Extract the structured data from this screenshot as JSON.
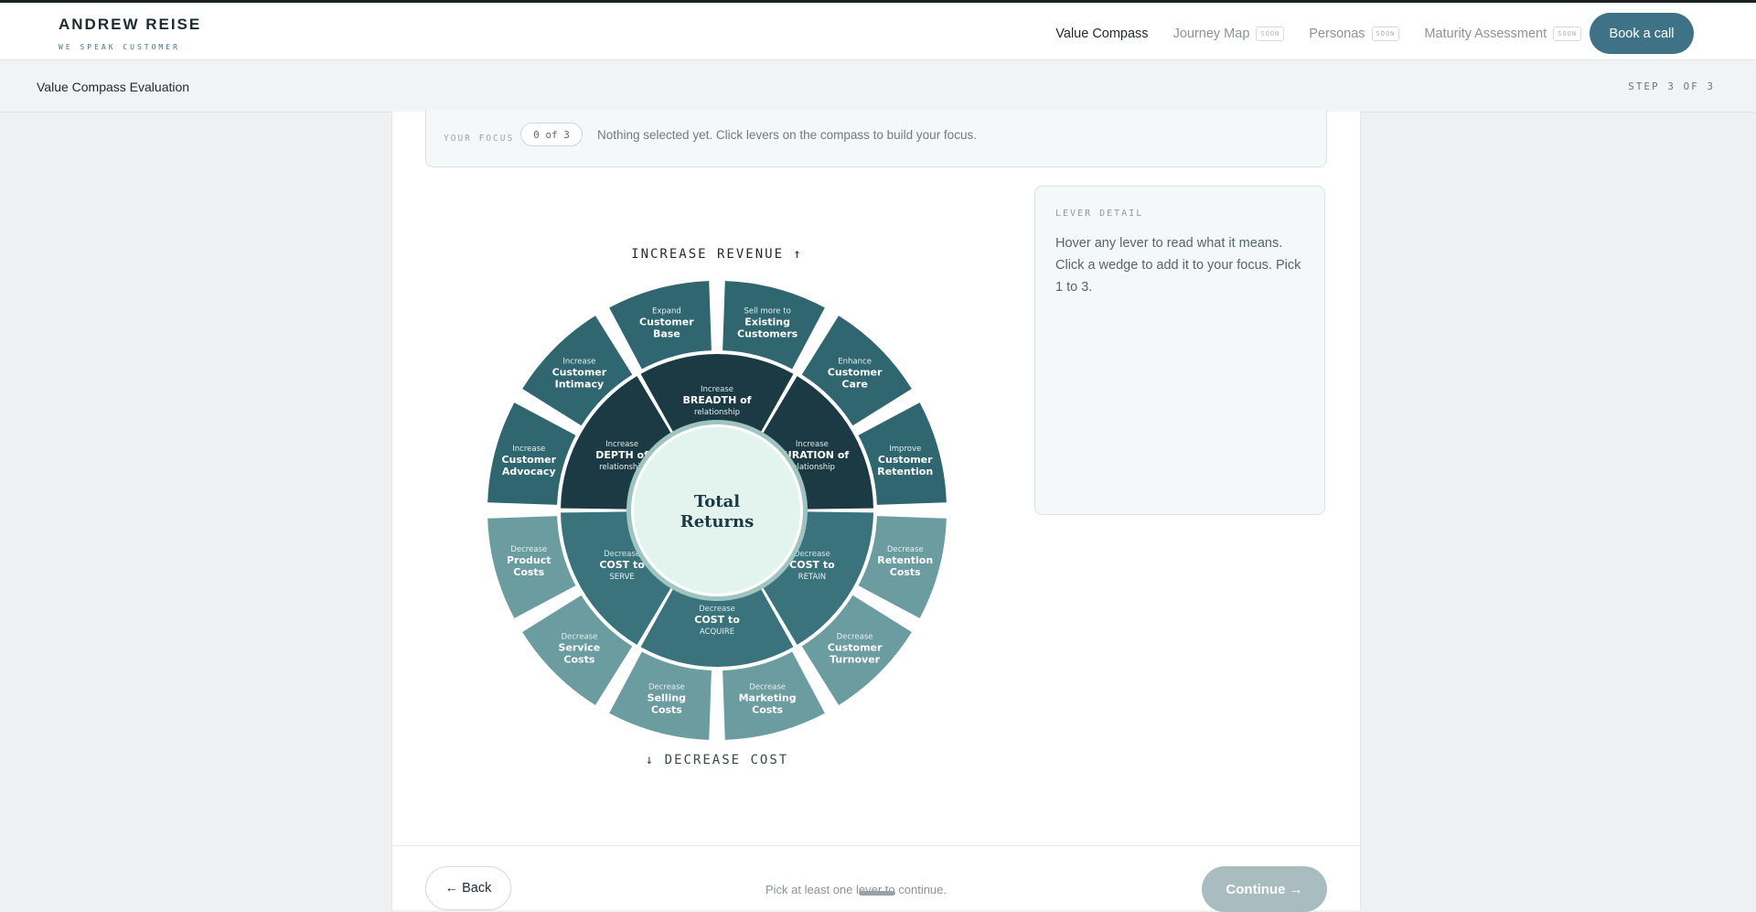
{
  "brand": {
    "name": "ANDREW REISE",
    "tagline": "WE SPEAK CUSTOMER"
  },
  "nav": {
    "items": [
      {
        "label": "Value Compass",
        "badge": ""
      },
      {
        "label": "Journey Map",
        "badge": "SOON"
      },
      {
        "label": "Personas",
        "badge": "SOON"
      },
      {
        "label": "Maturity Assessment",
        "badge": "SOON"
      }
    ],
    "cta": "Book a call"
  },
  "step": {
    "title": "Value Compass Evaluation",
    "counter": "STEP 3 OF 3"
  },
  "focus": {
    "label": "YOUR FOCUS",
    "count": "0 of 3",
    "hint": "Nothing selected yet. Click levers on the compass to build your focus."
  },
  "compass": {
    "top_label": "INCREASE REVENUE ↑",
    "bottom_label": "↓ DECREASE COST",
    "center": [
      "Total",
      "Returns"
    ],
    "outer": [
      {
        "pre": "Expand",
        "l1": "Customer",
        "l2": "Base"
      },
      {
        "pre": "Sell more to",
        "l1": "Existing",
        "l2": "Customers"
      },
      {
        "pre": "Enhance",
        "l1": "Customer",
        "l2": "Care"
      },
      {
        "pre": "Improve",
        "l1": "Customer",
        "l2": "Retention"
      },
      {
        "pre": "Decrease",
        "l1": "Retention",
        "l2": "Costs"
      },
      {
        "pre": "Decrease",
        "l1": "Customer",
        "l2": "Turnover"
      },
      {
        "pre": "Decrease",
        "l1": "Marketing",
        "l2": "Costs"
      },
      {
        "pre": "Decrease",
        "l1": "Selling",
        "l2": "Costs"
      },
      {
        "pre": "Decrease",
        "l1": "Service",
        "l2": "Costs"
      },
      {
        "pre": "Decrease",
        "l1": "Product",
        "l2": "Costs"
      },
      {
        "pre": "Increase",
        "l1": "Customer",
        "l2": "Advocacy"
      },
      {
        "pre": "Increase",
        "l1": "Customer",
        "l2": "Intimacy"
      }
    ],
    "inner": [
      {
        "pre": "Increase",
        "main": "BREADTH of",
        "sub": "relationship"
      },
      {
        "pre": "Increase",
        "main": "DURATION of",
        "sub": "relationship"
      },
      {
        "pre": "Decrease",
        "main": "COST to",
        "sub": "RETAIN"
      },
      {
        "pre": "Decrease",
        "main": "COST to",
        "sub": "ACQUIRE"
      },
      {
        "pre": "Decrease",
        "main": "COST to",
        "sub": "SERVE"
      },
      {
        "pre": "Increase",
        "main": "DEPTH of",
        "sub": "relationship"
      }
    ],
    "colors": {
      "outer_revenue": "#2f6670",
      "outer_cost": "#6a9ca0",
      "inner_revenue": "#1b3a43",
      "inner_cost": "#3a737b",
      "center_fill": "#e3f4ef",
      "center_ring": "#9ec4bf",
      "center_text": "#1b3a43"
    }
  },
  "detail": {
    "label": "LEVER DETAIL",
    "text": "Hover any lever to read what it means. Click a wedge to add it to your focus. Pick 1 to 3."
  },
  "footer": {
    "back": "← Back",
    "hint": "Pick at least one lever to continue.",
    "continue": "Continue →"
  }
}
